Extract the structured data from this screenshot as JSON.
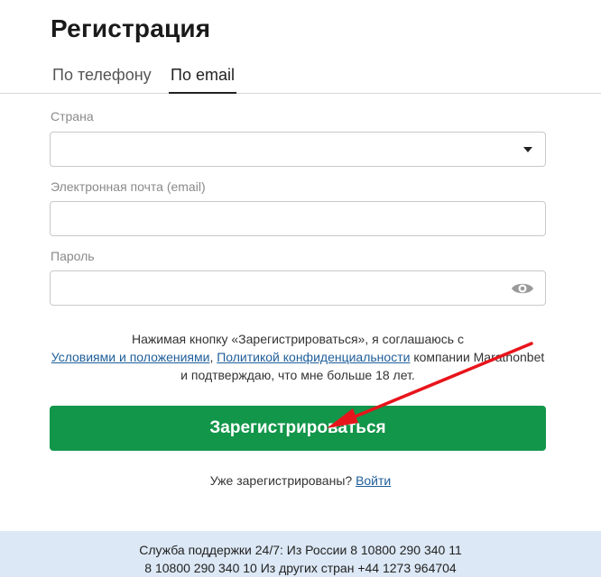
{
  "page": {
    "title": "Регистрация"
  },
  "tabs": [
    {
      "label": "По телефону",
      "active": false
    },
    {
      "label": "По email",
      "active": true
    }
  ],
  "form": {
    "country": {
      "label": "Страна",
      "value": ""
    },
    "email": {
      "label": "Электронная почта (email)",
      "value": ""
    },
    "password": {
      "label": "Пароль",
      "value": ""
    }
  },
  "consent": {
    "text_before": "Нажимая кнопку «Зарегистрироваться», я соглашаюсь с",
    "terms_link": "Условиями и положениями",
    "separator": ", ",
    "privacy_link": "Политикой конфиденциальности",
    "text_after": " компании Marathonbet и подтверждаю, что мне больше 18 лет."
  },
  "submit": {
    "label": "Зарегистрироваться"
  },
  "login": {
    "prompt": "Уже зарегистрированы? ",
    "link": "Войти"
  },
  "footer": {
    "line1": "Служба поддержки 24/7: Из России 8 10800 290 340 11",
    "line2": "8 10800 290 340 10 Из других стран +44 1273 964704"
  },
  "icons": {
    "dropdown": "chevron-down-icon",
    "password_toggle": "eye-icon",
    "annotation": "red-arrow"
  },
  "colors": {
    "primary_button": "#12964a",
    "link": "#1f5e9a",
    "footer_bg": "#dce8f5",
    "annotation_arrow": "#e8141b"
  }
}
